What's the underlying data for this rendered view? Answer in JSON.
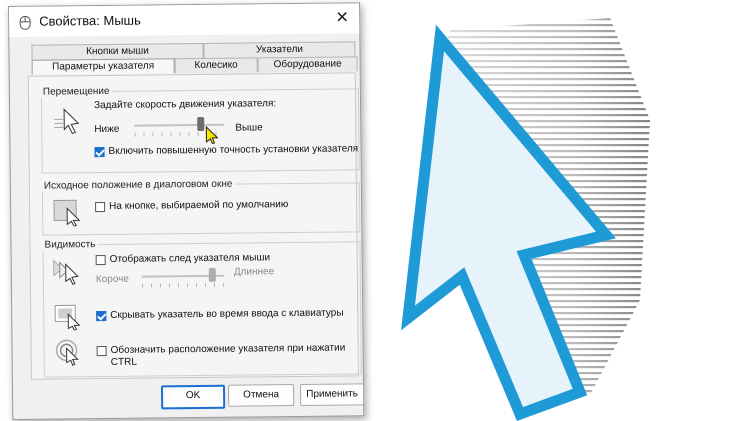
{
  "window": {
    "title": "Свойства: Мышь",
    "close_glyph": "✕"
  },
  "tabs": {
    "back_row": [
      {
        "label": "Кнопки мыши"
      },
      {
        "label": "Указатели"
      }
    ],
    "front_row": [
      {
        "label": "Параметры указателя",
        "active": true
      },
      {
        "label": "Колесико"
      },
      {
        "label": "Оборудование"
      }
    ]
  },
  "motion": {
    "group_label": "Перемещение",
    "speed_prompt": "Задайте скорость движения указателя:",
    "slow_label": "Ниже",
    "fast_label": "Выше",
    "speed_level": 0.73,
    "precision": {
      "label": "Включить повышенную точность установки указателя",
      "checked": true
    }
  },
  "snap_to": {
    "group_label": "Исходное положение в диалоговом окне",
    "option": {
      "label": "На кнопке, выбираемой по умолчанию",
      "checked": false
    }
  },
  "visibility": {
    "group_label": "Видимость",
    "trails": {
      "label": "Отображать след указателя мыши",
      "checked": false
    },
    "trail_short_label": "Короче",
    "trail_long_label": "Длиннее",
    "trail_level": 0.84,
    "hide_typing": {
      "label": "Скрывать указатель во время ввода с клавиатуры",
      "checked": true
    },
    "show_ctrl": {
      "label_line1": "Обозначить расположение указателя при нажатии",
      "label_line2": "CTRL",
      "checked": false
    }
  },
  "buttons": {
    "ok": "OK",
    "cancel": "Отмена",
    "apply": "Применить"
  },
  "icons": {
    "title": "mouse-icon",
    "speed": "pointer-speed-icon",
    "snap": "snap-to-button-icon",
    "trails": "pointer-trails-icon",
    "hide": "hide-pointer-icon",
    "ctrl": "locate-pointer-icon",
    "busy": "yellow-pointer-cursor-icon",
    "art": "large-arrow-cursor-icon"
  },
  "colors": {
    "accent": "#1a6fd1",
    "cursor_outline": "#1e9ad6",
    "cursor_fill": "#e6f3fa"
  }
}
